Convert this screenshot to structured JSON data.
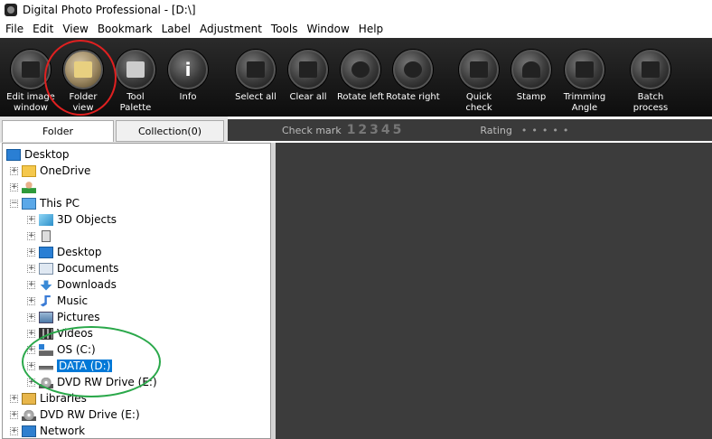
{
  "window": {
    "title": "Digital Photo Professional - [D:\\]"
  },
  "menu": [
    "File",
    "Edit",
    "View",
    "Bookmark",
    "Label",
    "Adjustment",
    "Tools",
    "Window",
    "Help"
  ],
  "toolbar": {
    "buttons": [
      {
        "label": "Edit image\nwindow",
        "icon": "edit-image-icon"
      },
      {
        "label": "Folder\nview",
        "icon": "folder-view-icon",
        "active": true
      },
      {
        "label": "Tool\nPalette",
        "icon": "tool-palette-icon"
      },
      {
        "label": "Info",
        "icon": "info-icon"
      },
      {
        "label": "Select all",
        "icon": "select-all-icon"
      },
      {
        "label": "Clear all",
        "icon": "clear-all-icon"
      },
      {
        "label": "Rotate left",
        "icon": "rotate-left-icon"
      },
      {
        "label": "Rotate right",
        "icon": "rotate-right-icon"
      },
      {
        "label": "Quick\ncheck",
        "icon": "quick-check-icon"
      },
      {
        "label": "Stamp",
        "icon": "stamp-icon"
      },
      {
        "label": "Trimming\nAngle",
        "icon": "trimming-angle-icon"
      },
      {
        "label": "Batch\nprocess",
        "icon": "batch-process-icon"
      }
    ],
    "info_glyph": "i"
  },
  "tabs": {
    "folder": "Folder",
    "collection": "Collection(0)"
  },
  "filter": {
    "check_mark_label": "Check mark",
    "check_numbers": "12345",
    "rating_label": "Rating",
    "rating_dots": "•••••"
  },
  "tree": [
    {
      "label": "Desktop",
      "icon": "desktop-icon"
    },
    {
      "label": "OneDrive",
      "icon": "folder-icon"
    },
    {
      "label": "",
      "icon": "user-icon"
    },
    {
      "label": "This PC",
      "icon": "pc-icon"
    },
    {
      "label": "3D Objects",
      "icon": "3d-objects-icon"
    },
    {
      "label": "",
      "icon": "phone-icon"
    },
    {
      "label": "Desktop",
      "icon": "desktop-icon"
    },
    {
      "label": "Documents",
      "icon": "documents-icon"
    },
    {
      "label": "Downloads",
      "icon": "downloads-icon"
    },
    {
      "label": "Music",
      "icon": "music-icon"
    },
    {
      "label": "Pictures",
      "icon": "pictures-icon"
    },
    {
      "label": "Videos",
      "icon": "videos-icon"
    },
    {
      "label": "OS (C:)",
      "icon": "os-drive-icon"
    },
    {
      "label": "DATA (D:)",
      "icon": "drive-icon",
      "selected": true
    },
    {
      "label": "DVD RW Drive (E:)",
      "icon": "dvd-icon"
    },
    {
      "label": "Libraries",
      "icon": "libraries-icon"
    },
    {
      "label": "DVD RW Drive (E:)",
      "icon": "dvd-icon"
    },
    {
      "label": "Network",
      "icon": "network-icon"
    }
  ],
  "expanders": {
    "collapsed": "+",
    "expanded": "−"
  }
}
